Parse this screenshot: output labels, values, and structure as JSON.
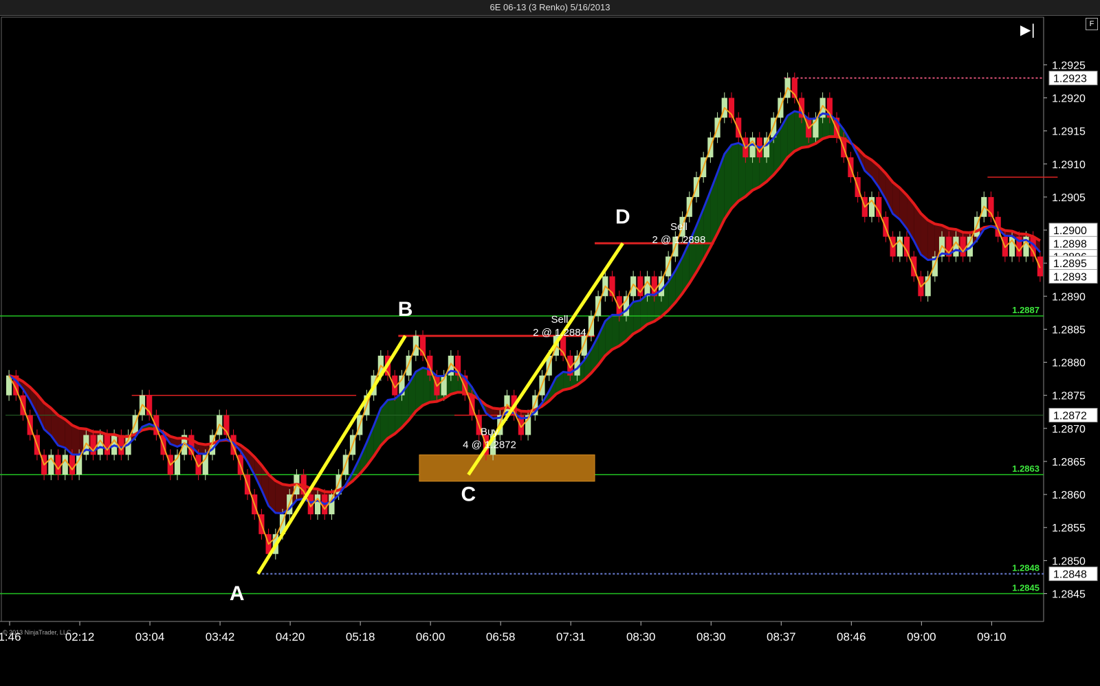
{
  "window": {
    "title": "6E 06-13 (3 Renko)  5/16/2013"
  },
  "toolbar": {
    "end_glyph": "▶|",
    "f_label": "F"
  },
  "footer": {
    "copyright": "© 2013 NinjaTrader, LLC"
  },
  "colors": {
    "background": "#000000",
    "up_brick": "#bfe6a8",
    "down_brick": "#e8102a",
    "fast_line": "#f2a11e",
    "mid_line": "#1c2fd8",
    "slow_line": "#e21b1b",
    "bull_cloud": "#0d4d0d",
    "bear_cloud": "#5a0a0a",
    "support": "#22c322",
    "resistance": "#dd2222",
    "trend": "#ffff22",
    "zone": "#a86a10"
  },
  "chart_data": {
    "type": "renko",
    "instrument": "6E 06-13",
    "brick_size": 0.0003,
    "y_range": [
      1.2841,
      1.2932
    ],
    "y_ticks": [
      "1.2925",
      "1.2920",
      "1.2915",
      "1.2910",
      "1.2905",
      "1.2900",
      "1.2895",
      "1.2890",
      "1.2885",
      "1.2880",
      "1.2875",
      "1.2870",
      "1.2865",
      "1.2860",
      "1.2855",
      "1.2850",
      "1.2845"
    ],
    "x_labels": [
      "1:46",
      "02:12",
      "03:04",
      "03:42",
      "04:20",
      "05:18",
      "06:00",
      "06:58",
      "07:31",
      "08:30",
      "08:30",
      "08:37",
      "08:46",
      "09:00",
      "09:10"
    ],
    "x_label_bricks": [
      0,
      10,
      20,
      30,
      40,
      50,
      60,
      70,
      80,
      90,
      100,
      110,
      120,
      130,
      140
    ],
    "price_tags": [
      "1.2923",
      "1.2900",
      "1.2898",
      "1.2896",
      "1.2895",
      "1.2893",
      "1.2872",
      "1.2848"
    ],
    "level_labels": [
      "1.2887",
      "1.2863",
      "1.2848",
      "1.2845"
    ],
    "closes": [
      1.2878,
      1.2875,
      1.2872,
      1.2869,
      1.2866,
      1.2863,
      1.2866,
      1.2863,
      1.2866,
      1.2863,
      1.2866,
      1.2869,
      1.2866,
      1.2869,
      1.2866,
      1.2869,
      1.2866,
      1.2869,
      1.2872,
      1.2875,
      1.2872,
      1.2869,
      1.2866,
      1.2863,
      1.2866,
      1.2869,
      1.2866,
      1.2863,
      1.2866,
      1.2869,
      1.2872,
      1.2869,
      1.2866,
      1.2863,
      1.286,
      1.2857,
      1.2854,
      1.2851,
      1.2854,
      1.2857,
      1.286,
      1.2863,
      1.286,
      1.2857,
      1.286,
      1.2857,
      1.286,
      1.2863,
      1.2866,
      1.2869,
      1.2872,
      1.2875,
      1.2878,
      1.2881,
      1.2878,
      1.2875,
      1.2878,
      1.2881,
      1.2884,
      1.2881,
      1.2878,
      1.2875,
      1.2878,
      1.2881,
      1.2878,
      1.2875,
      1.2872,
      1.2869,
      1.2866,
      1.2869,
      1.2872,
      1.2875,
      1.2872,
      1.2869,
      1.2872,
      1.2875,
      1.2878,
      1.2881,
      1.2884,
      1.2881,
      1.2878,
      1.2881,
      1.2884,
      1.2887,
      1.289,
      1.2893,
      1.289,
      1.2887,
      1.289,
      1.2893,
      1.289,
      1.2893,
      1.289,
      1.2893,
      1.2896,
      1.2899,
      1.2902,
      1.2905,
      1.2908,
      1.2911,
      1.2914,
      1.2917,
      1.292,
      1.2917,
      1.2914,
      1.2911,
      1.2914,
      1.2911,
      1.2914,
      1.2917,
      1.292,
      1.2923,
      1.292,
      1.2917,
      1.2914,
      1.2917,
      1.292,
      1.2917,
      1.2914,
      1.2911,
      1.2908,
      1.2905,
      1.2902,
      1.2905,
      1.2902,
      1.2899,
      1.2896,
      1.2899,
      1.2896,
      1.2893,
      1.289,
      1.2893,
      1.2896,
      1.2899,
      1.2896,
      1.2899,
      1.2896,
      1.2899,
      1.2902,
      1.2905,
      1.2902,
      1.2899,
      1.2896,
      1.2899,
      1.2896,
      1.2899,
      1.2896,
      1.2893
    ],
    "annotations": [
      {
        "label": "A",
        "text": ""
      },
      {
        "label": "B",
        "text": ""
      },
      {
        "label": "C",
        "text": ""
      },
      {
        "label": "D",
        "text": ""
      },
      {
        "label": "Sell",
        "text": "2 @ 1.2884"
      },
      {
        "label": "Sell",
        "text": "2 @ 1.2898"
      },
      {
        "label": "Buy",
        "text": "4 @ 1.2872"
      }
    ],
    "levels": {
      "support_solid": [
        1.2845,
        1.2863,
        1.2887
      ],
      "dotted_top": [
        1.2923
      ],
      "dotted_low": [
        1.2848
      ],
      "resistance": [
        1.2884,
        1.2898,
        1.2872,
        1.2875,
        1.2908
      ],
      "thin_mid": [
        1.2872
      ]
    }
  }
}
